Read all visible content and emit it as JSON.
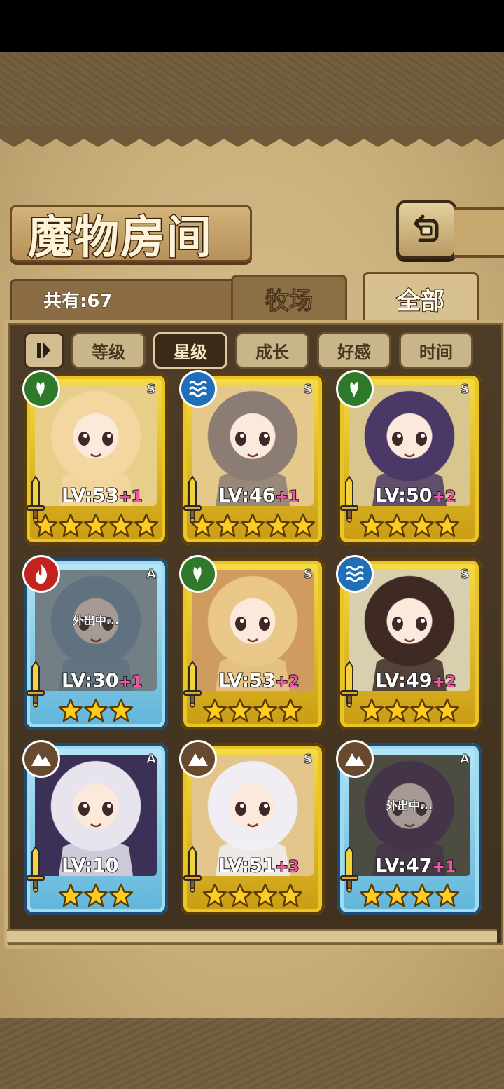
{
  "title": "魔物房间",
  "count_label": "共有:67",
  "tabs": [
    {
      "label": "牧场",
      "active": false
    },
    {
      "label": "全部",
      "active": true
    }
  ],
  "sort_buttons": [
    {
      "label": "等级",
      "active": false
    },
    {
      "label": "星级",
      "active": true
    },
    {
      "label": "成长",
      "active": false
    },
    {
      "label": "好感",
      "active": false
    },
    {
      "label": "时间",
      "active": false
    }
  ],
  "colors": {
    "gold_frame": "#f2d23a",
    "blue_frame": "#8fd3ef",
    "element_nature": "#2f7a2a",
    "element_water": "#1e6fb8",
    "element_fire": "#c2231f",
    "element_earth": "#6a4a2e",
    "plus_text": "#f255a6"
  },
  "monsters": [
    {
      "level": "LV:53",
      "plus": "+1",
      "stars": 5,
      "grade": "S",
      "element": "nature",
      "frame": "gold",
      "away": false,
      "hair": "#f3d6a0",
      "bg": "#e7cf8a"
    },
    {
      "level": "LV:46",
      "plus": "+1",
      "stars": 5,
      "grade": "S",
      "element": "water",
      "frame": "gold",
      "away": false,
      "hair": "#8b7d74",
      "bg": "#e4c98a"
    },
    {
      "level": "LV:50",
      "plus": "+2",
      "stars": 4,
      "grade": "S",
      "element": "nature",
      "frame": "gold",
      "away": false,
      "hair": "#4a3866",
      "bg": "#d8c68e"
    },
    {
      "level": "LV:30",
      "plus": "+1",
      "stars": 3,
      "grade": "A",
      "element": "fire",
      "frame": "blue",
      "away": true,
      "away_text": "外出中...",
      "hair": "#7f9fb8",
      "bg": "#9fb7c1"
    },
    {
      "level": "LV:53",
      "plus": "+2",
      "stars": 4,
      "grade": "S",
      "element": "nature",
      "frame": "gold",
      "away": false,
      "hair": "#e8c788",
      "bg": "#cf9b5e"
    },
    {
      "level": "LV:49",
      "plus": "+2",
      "stars": 4,
      "grade": "S",
      "element": "water",
      "frame": "gold",
      "away": false,
      "hair": "#3e2a22",
      "bg": "#d8cfae"
    },
    {
      "level": "LV:10",
      "plus": "",
      "stars": 3,
      "grade": "A",
      "element": "earth",
      "frame": "blue",
      "away": false,
      "hair": "#e8e4ee",
      "bg": "#3b3156"
    },
    {
      "level": "LV:51",
      "plus": "+3",
      "stars": 4,
      "grade": "S",
      "element": "earth",
      "frame": "gold",
      "away": false,
      "hair": "#f0eef4",
      "bg": "#e3c58b"
    },
    {
      "level": "LV:47",
      "plus": "+1",
      "stars": 4,
      "grade": "A",
      "element": "earth",
      "frame": "blue",
      "away": true,
      "away_text": "外出中...",
      "hair": "#4c2f55",
      "bg": "#5a5a4a"
    }
  ]
}
